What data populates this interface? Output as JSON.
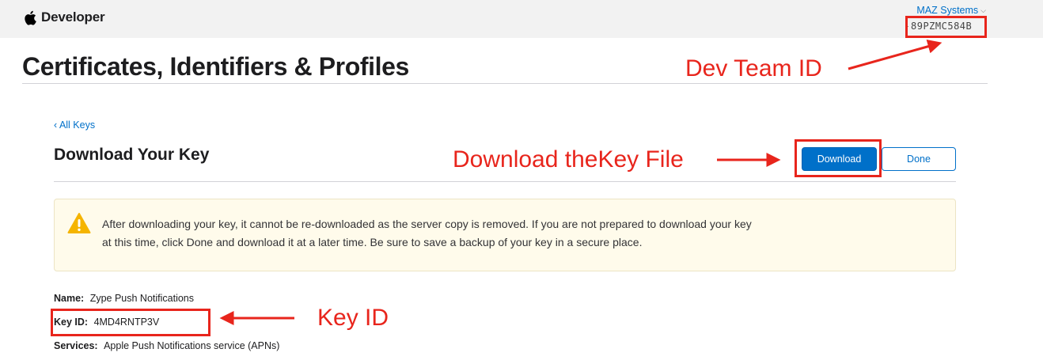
{
  "header": {
    "brand_label": "Developer",
    "team_name": "MAZ Systems",
    "team_id": "89PZMC584B"
  },
  "page": {
    "title": "Certificates, Identifiers & Profiles",
    "back_link": "‹ All Keys",
    "section_title": "Download Your Key"
  },
  "actions": {
    "download_label": "Download",
    "done_label": "Done"
  },
  "warning": {
    "line1": "After downloading your key, it cannot be re-downloaded as the server copy is removed. If you are not prepared to download your key",
    "line2": "at this time, click Done and download it at a later time. Be sure to save a backup of your key in a secure place."
  },
  "key_details": {
    "name_label": "Name:",
    "name_value": "Zype Push Notifications",
    "key_id_label": "Key ID:",
    "key_id_value": "4MD4RNTP3V",
    "services_label": "Services:",
    "services_value": "Apple Push Notifications service (APNs)"
  },
  "annotations": {
    "team_id": "Dev Team ID",
    "download": "Download theKey File",
    "key_id": "Key ID",
    "color": "#e8251c"
  },
  "colors": {
    "accent": "#0070c9",
    "warning_bg": "#fffbeb",
    "warning_icon": "#f5b400"
  }
}
